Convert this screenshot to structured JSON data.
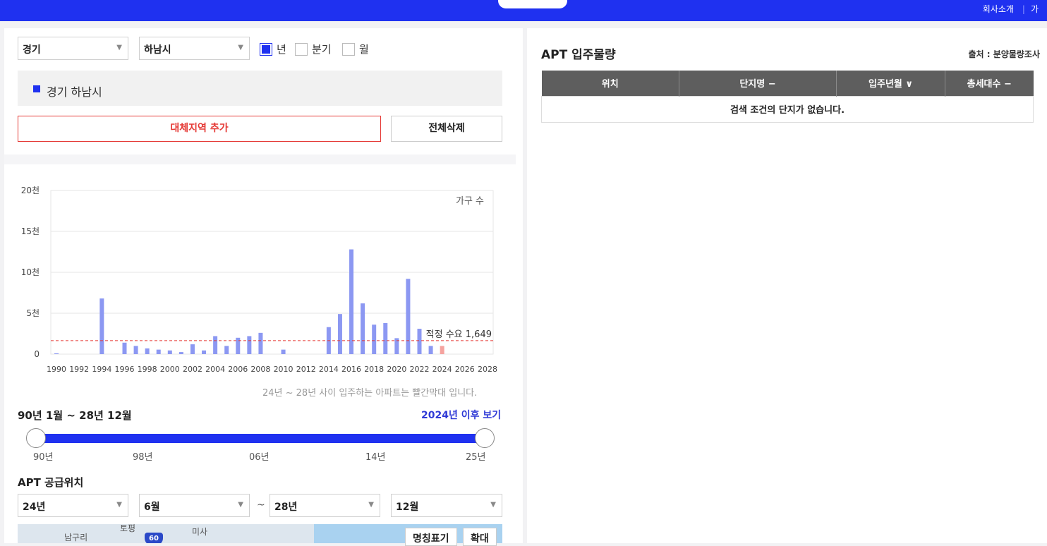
{
  "header": {
    "links": [
      "회사소개",
      "가"
    ]
  },
  "filters": {
    "province": "경기",
    "city": "하남시",
    "period_options": [
      {
        "label": "년",
        "checked": true
      },
      {
        "label": "분기",
        "checked": false
      },
      {
        "label": "월",
        "checked": false
      }
    ]
  },
  "selected_region": "경기 하남시",
  "buttons": {
    "add_region": "대체지역 추가",
    "clear_all": "전체삭제"
  },
  "chart_data": {
    "type": "bar",
    "unit_label": "가구 수",
    "y_ticks": [
      "20천",
      "15천",
      "10천",
      "5천",
      "0"
    ],
    "ylim": [
      0,
      20000
    ],
    "x_tick_labels": [
      "1990",
      "1992",
      "1994",
      "1996",
      "1998",
      "2000",
      "2002",
      "2004",
      "2006",
      "2008",
      "2010",
      "2012",
      "2014",
      "2016",
      "2018",
      "2020",
      "2022",
      "2024",
      "2026",
      "2028"
    ],
    "categories": [
      "1990",
      "1991",
      "1992",
      "1993",
      "1994",
      "1995",
      "1996",
      "1997",
      "1998",
      "1999",
      "2000",
      "2001",
      "2002",
      "2003",
      "2004",
      "2005",
      "2006",
      "2007",
      "2008",
      "2009",
      "2010",
      "2011",
      "2012",
      "2013",
      "2014",
      "2015",
      "2016",
      "2017",
      "2018",
      "2019",
      "2020",
      "2021",
      "2022",
      "2023",
      "2024",
      "2025",
      "2026",
      "2027",
      "2028"
    ],
    "values": [
      100,
      0,
      0,
      0,
      6800,
      0,
      1400,
      1000,
      700,
      550,
      450,
      250,
      1200,
      450,
      2200,
      1000,
      2000,
      2200,
      2600,
      0,
      550,
      0,
      0,
      0,
      3300,
      4900,
      12800,
      6200,
      3600,
      3800,
      1950,
      9200,
      3100,
      1000,
      1000,
      0,
      0,
      0,
      0
    ],
    "highlight_from": "2024",
    "colors": {
      "normal": "#8c98f2",
      "highlight": "#f5a39f",
      "reference": "#e53935"
    },
    "reference_line": {
      "value": 1649,
      "label": "적정 수요 1,649"
    },
    "grid": true
  },
  "chart_note": "24년 ~ 28년 사이 입주하는 아파트는 빨간막대 입니다.",
  "range": {
    "label": "90년 1월 ~ 28년 12월",
    "after_link": "2024년 이후 보기",
    "ticks": [
      "90년",
      "98년",
      "06년",
      "14년",
      "25년"
    ]
  },
  "supply": {
    "title": "APT 공급위치",
    "from_year": "24년",
    "from_month": "6월",
    "separator": "~",
    "to_year": "28년",
    "to_month": "12월"
  },
  "map": {
    "labels": [
      "남구리",
      "토평",
      "미사"
    ],
    "shield": "60",
    "name_toggle": "명칭표기",
    "zoom": "확대"
  },
  "occupancy": {
    "title": "APT 입주물량",
    "source": "출처 : 분양물량조사",
    "columns": [
      "위치",
      "단지명 −",
      "입주년월 ∨",
      "총세대수 −"
    ],
    "empty_message": "검색 조건의 단지가 없습니다."
  }
}
